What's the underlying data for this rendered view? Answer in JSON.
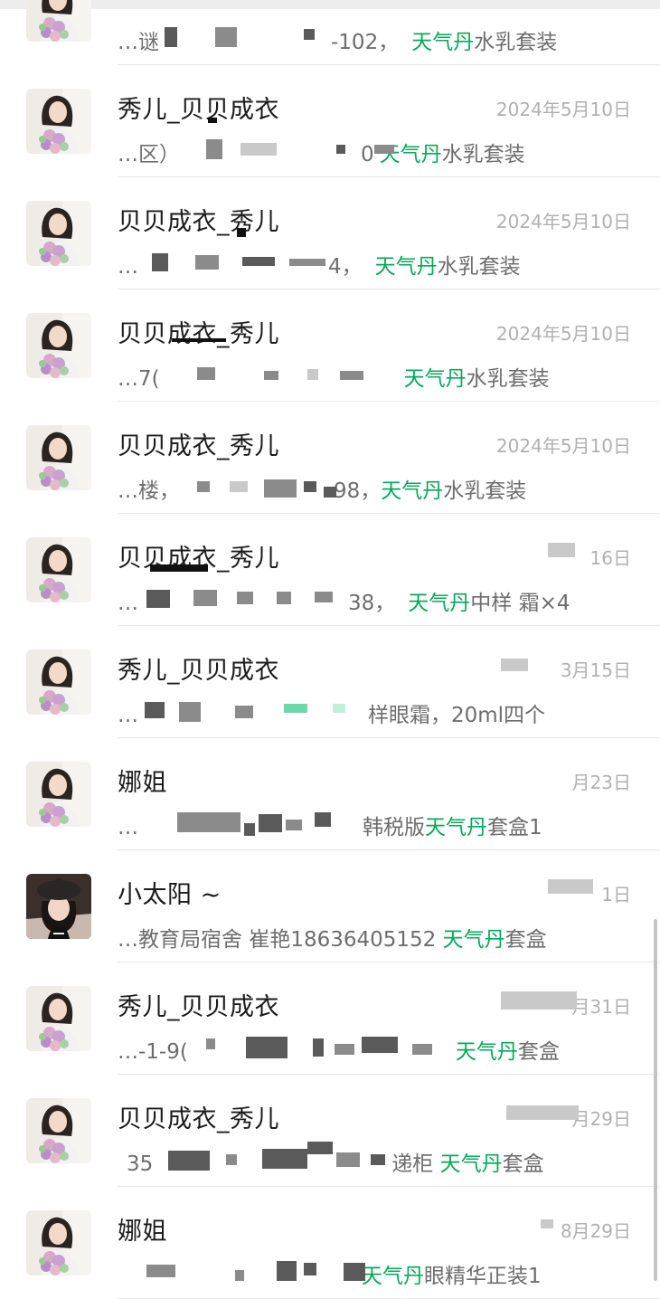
{
  "accent_color": "#07a85a",
  "keyword": "天气丹",
  "items": [
    {
      "name": "",
      "date": "",
      "pre": "…谜",
      "mid": "-102，",
      "hl": "天气丹",
      "post": "水乳套装",
      "avatar": "flowers-avatar"
    },
    {
      "name": "秀儿_贝贝成衣",
      "date": "2024年5月10日",
      "pre": "…区）",
      "mid": "0",
      "hl": "天气丹",
      "post": "水乳套装",
      "avatar": "flowers-avatar"
    },
    {
      "name": "贝贝成衣_秀儿",
      "date": "2024年5月10日",
      "pre": "…",
      "mid": "4，",
      "hl": "天气丹",
      "post": "水乳套装",
      "avatar": "flowers-avatar"
    },
    {
      "name": "贝贝成衣_秀儿",
      "date": "2024年5月10日",
      "pre": "…7(",
      "mid": "",
      "hl": "天气丹",
      "post": "水乳套装",
      "avatar": "flowers-avatar"
    },
    {
      "name": "贝贝成衣_秀儿",
      "date": "2024年5月10日",
      "pre": "…楼，",
      "mid": "98，",
      "hl": "天气丹",
      "post": "水乳套装",
      "avatar": "flowers-avatar"
    },
    {
      "name": "贝贝成衣_秀儿",
      "date": "16日",
      "pre": "…",
      "mid": "38，",
      "hl": "天气丹",
      "post": "中样 霜×4",
      "avatar": "flowers-avatar"
    },
    {
      "name": "秀儿_贝贝成衣",
      "date": "3月15日",
      "pre": "…",
      "mid": "",
      "hl": "",
      "post": "样眼霜，20ml四个",
      "avatar": "flowers-avatar"
    },
    {
      "name": "娜姐",
      "date": "月23日",
      "pre": "…",
      "mid": "韩税版",
      "hl": "天气丹",
      "post": "套盒1",
      "avatar": "flowers-avatar"
    },
    {
      "name": "小太阳 ~",
      "date": "1日",
      "pre": "…教育局宿舍 崔艳18636405152 ",
      "mid": "",
      "hl": "天气丹",
      "post": "套盒",
      "avatar": "beret-avatar"
    },
    {
      "name": "秀儿_贝贝成衣",
      "date": "月31日",
      "pre": "…-1-9(",
      "mid": "",
      "hl": "天气丹",
      "post": "套盒",
      "avatar": "flowers-avatar"
    },
    {
      "name": "贝贝成衣_秀儿",
      "date": "月29日",
      "pre": "35",
      "mid": "递柜 ",
      "hl": "天气丹",
      "post": "套盒",
      "avatar": "flowers-avatar"
    },
    {
      "name": "娜姐",
      "date": "8月29日",
      "pre": "",
      "mid": "",
      "hl": "天气丹",
      "post": "眼精华正装1",
      "avatar": "flowers-avatar"
    }
  ]
}
